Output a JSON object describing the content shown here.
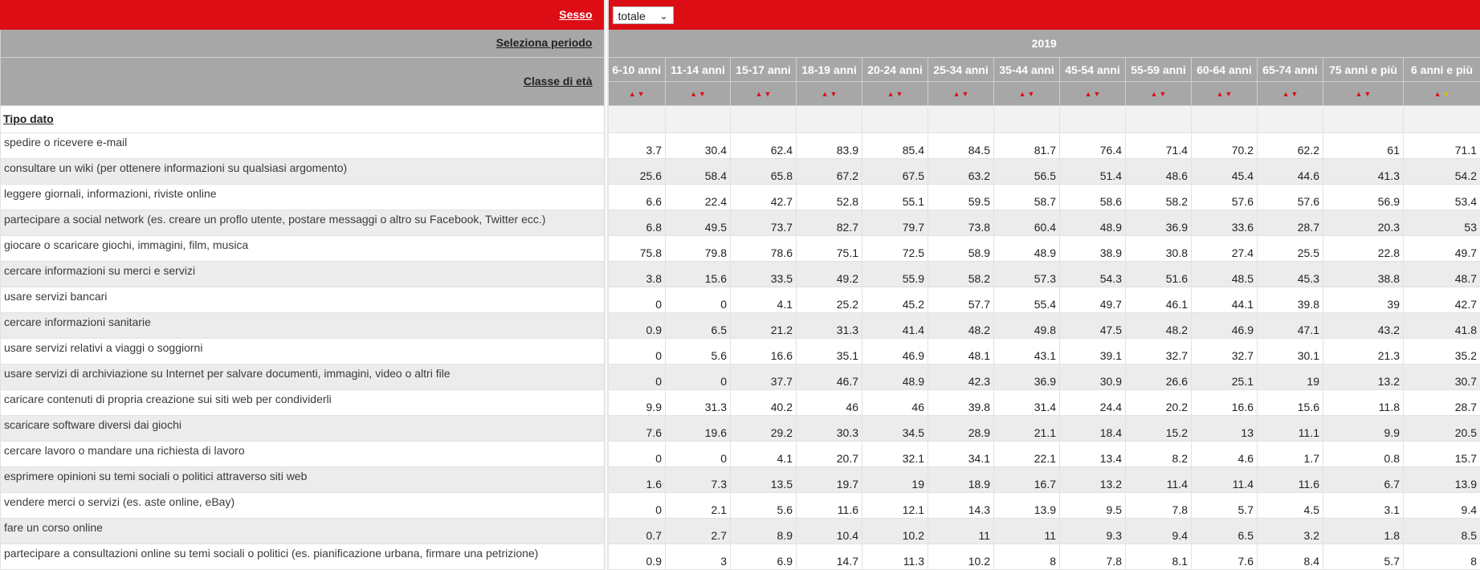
{
  "filters": {
    "sex_label": "Sesso",
    "sex_value": "totale",
    "period_label": "Seleziona periodo",
    "period_value": "2019",
    "age_label": "Classe di età"
  },
  "age_classes": [
    "6-10 anni",
    "11-14 anni",
    "15-17 anni",
    "18-19 anni",
    "20-24 anni",
    "25-34 anni",
    "35-44 anni",
    "45-54 anni",
    "55-59 anni",
    "60-64 anni",
    "65-74 anni",
    "75 anni e più",
    "6 anni e più"
  ],
  "row_header_label": "Tipo dato",
  "rows": [
    {
      "label": "spedire o ricevere e-mail",
      "values": [
        "3.7",
        "30.4",
        "62.4",
        "83.9",
        "85.4",
        "84.5",
        "81.7",
        "76.4",
        "71.4",
        "70.2",
        "62.2",
        "61",
        "71.1"
      ]
    },
    {
      "label": "consultare un wiki (per ottenere informazioni su qualsiasi argomento)",
      "values": [
        "25.6",
        "58.4",
        "65.8",
        "67.2",
        "67.5",
        "63.2",
        "56.5",
        "51.4",
        "48.6",
        "45.4",
        "44.6",
        "41.3",
        "54.2"
      ]
    },
    {
      "label": "leggere giornali, informazioni, riviste online",
      "values": [
        "6.6",
        "22.4",
        "42.7",
        "52.8",
        "55.1",
        "59.5",
        "58.7",
        "58.6",
        "58.2",
        "57.6",
        "57.6",
        "56.9",
        "53.4"
      ]
    },
    {
      "label": "partecipare a social network (es. creare un proflo utente, postare messaggi o altro su Facebook, Twitter ecc.)",
      "values": [
        "6.8",
        "49.5",
        "73.7",
        "82.7",
        "79.7",
        "73.8",
        "60.4",
        "48.9",
        "36.9",
        "33.6",
        "28.7",
        "20.3",
        "53"
      ]
    },
    {
      "label": "giocare o scaricare giochi, immagini, film, musica",
      "values": [
        "75.8",
        "79.8",
        "78.6",
        "75.1",
        "72.5",
        "58.9",
        "48.9",
        "38.9",
        "30.8",
        "27.4",
        "25.5",
        "22.8",
        "49.7"
      ]
    },
    {
      "label": "cercare informazioni su merci e servizi",
      "values": [
        "3.8",
        "15.6",
        "33.5",
        "49.2",
        "55.9",
        "58.2",
        "57.3",
        "54.3",
        "51.6",
        "48.5",
        "45.3",
        "38.8",
        "48.7"
      ]
    },
    {
      "label": "usare servizi bancari",
      "values": [
        "0",
        "0",
        "4.1",
        "25.2",
        "45.2",
        "57.7",
        "55.4",
        "49.7",
        "46.1",
        "44.1",
        "39.8",
        "39",
        "42.7"
      ]
    },
    {
      "label": "cercare informazioni sanitarie",
      "values": [
        "0.9",
        "6.5",
        "21.2",
        "31.3",
        "41.4",
        "48.2",
        "49.8",
        "47.5",
        "48.2",
        "46.9",
        "47.1",
        "43.2",
        "41.8"
      ]
    },
    {
      "label": "usare servizi relativi a viaggi o soggiorni",
      "values": [
        "0",
        "5.6",
        "16.6",
        "35.1",
        "46.9",
        "48.1",
        "43.1",
        "39.1",
        "32.7",
        "32.7",
        "30.1",
        "21.3",
        "35.2"
      ]
    },
    {
      "label": "usare servizi di archiviazione su Internet per salvare documenti, immagini, video o altri file",
      "values": [
        "0",
        "0",
        "37.7",
        "46.7",
        "48.9",
        "42.3",
        "36.9",
        "30.9",
        "26.6",
        "25.1",
        "19",
        "13.2",
        "30.7"
      ]
    },
    {
      "label": "caricare contenuti di propria creazione sui siti web per condividerli",
      "values": [
        "9.9",
        "31.3",
        "40.2",
        "46",
        "46",
        "39.8",
        "31.4",
        "24.4",
        "20.2",
        "16.6",
        "15.6",
        "11.8",
        "28.7"
      ]
    },
    {
      "label": "scaricare software diversi dai giochi",
      "values": [
        "7.6",
        "19.6",
        "29.2",
        "30.3",
        "34.5",
        "28.9",
        "21.1",
        "18.4",
        "15.2",
        "13",
        "11.1",
        "9.9",
        "20.5"
      ]
    },
    {
      "label": "cercare lavoro o mandare una richiesta di lavoro",
      "values": [
        "0",
        "0",
        "4.1",
        "20.7",
        "32.1",
        "34.1",
        "22.1",
        "13.4",
        "8.2",
        "4.6",
        "1.7",
        "0.8",
        "15.7"
      ]
    },
    {
      "label": "esprimere opinioni su temi sociali o politici attraverso siti web",
      "values": [
        "1.6",
        "7.3",
        "13.5",
        "19.7",
        "19",
        "18.9",
        "16.7",
        "13.2",
        "11.4",
        "11.4",
        "11.6",
        "6.7",
        "13.9"
      ]
    },
    {
      "label": "vendere merci o servizi (es. aste online, eBay)",
      "values": [
        "0",
        "2.1",
        "5.6",
        "11.6",
        "12.1",
        "14.3",
        "13.9",
        "9.5",
        "7.8",
        "5.7",
        "4.5",
        "3.1",
        "9.4"
      ]
    },
    {
      "label": "fare un corso online",
      "values": [
        "0.7",
        "2.7",
        "8.9",
        "10.4",
        "10.2",
        "11",
        "11",
        "9.3",
        "9.4",
        "6.5",
        "3.2",
        "1.8",
        "8.5"
      ]
    },
    {
      "label": "partecipare a consultazioni online su temi sociali o politici (es. pianificazione urbana, firmare una petrizione)",
      "values": [
        "0.9",
        "3",
        "6.9",
        "14.7",
        "11.3",
        "10.2",
        "8",
        "7.8",
        "8.1",
        "7.6",
        "8.4",
        "5.7",
        "8"
      ]
    }
  ],
  "colors": {
    "header_red": "#dc0d15",
    "header_gray": "#a7a7a7",
    "row_alt": "#ececec"
  }
}
